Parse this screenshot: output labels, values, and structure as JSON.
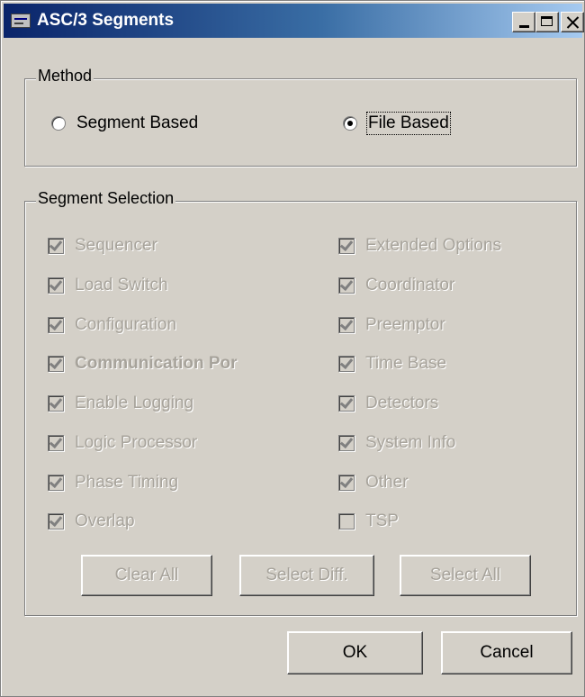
{
  "window": {
    "title": "ASC/3 Segments",
    "icon": "app-window-icon"
  },
  "method": {
    "title": "Method",
    "options": [
      {
        "label": "Segment Based",
        "selected": false
      },
      {
        "label": "File Based",
        "selected": true
      }
    ]
  },
  "segment_selection": {
    "title": "Segment Selection",
    "left_column": [
      {
        "label": "Sequencer",
        "checked": true
      },
      {
        "label": "Load Switch",
        "checked": true
      },
      {
        "label": "Configuration",
        "checked": true
      },
      {
        "label": "Communication Por",
        "checked": true
      },
      {
        "label": "Enable Logging",
        "checked": true
      },
      {
        "label": "Logic Processor",
        "checked": true
      },
      {
        "label": "Phase Timing",
        "checked": true
      },
      {
        "label": "Overlap",
        "checked": true
      }
    ],
    "right_column": [
      {
        "label": "Extended Options",
        "checked": true
      },
      {
        "label": "Coordinator",
        "checked": true
      },
      {
        "label": "Preemptor",
        "checked": true
      },
      {
        "label": "Time Base",
        "checked": true
      },
      {
        "label": "Detectors",
        "checked": true
      },
      {
        "label": "System Info",
        "checked": true
      },
      {
        "label": "Other",
        "checked": true
      },
      {
        "label": "TSP",
        "checked": false
      }
    ],
    "buttons": {
      "clear_all": "Clear All",
      "select_diff": "Select Diff.",
      "select_all": "Select All"
    }
  },
  "footer": {
    "ok": "OK",
    "cancel": "Cancel"
  }
}
